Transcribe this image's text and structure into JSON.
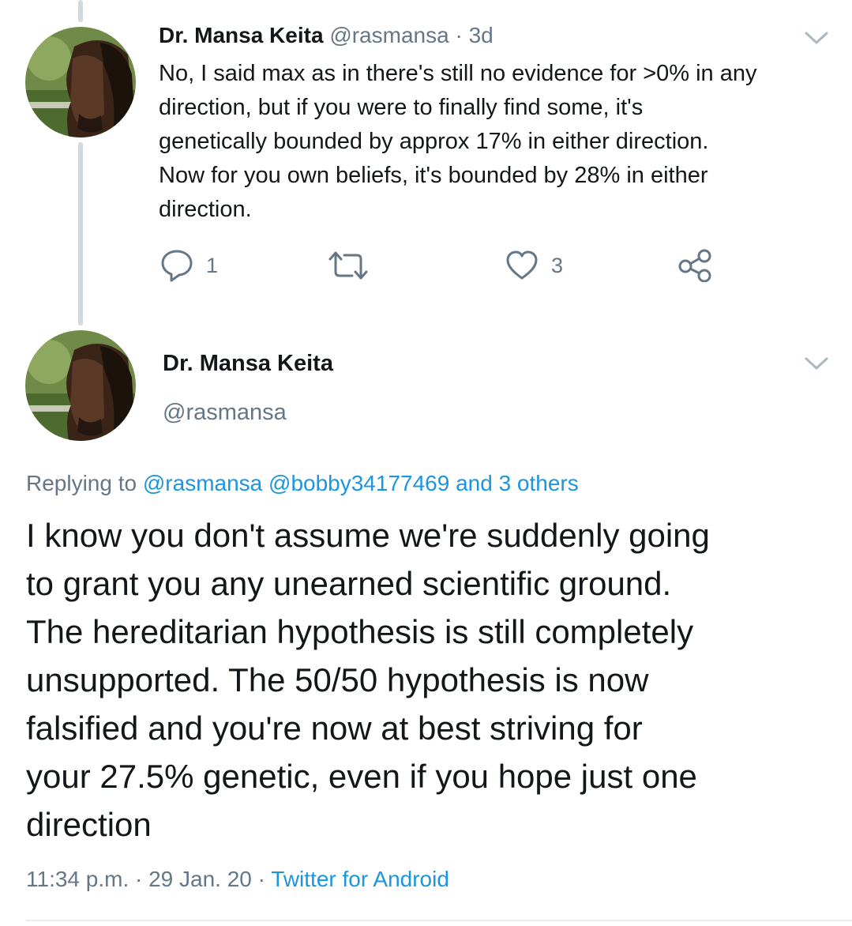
{
  "tweet1": {
    "name": "Dr. Mansa Keita",
    "handle": "@rasmansa",
    "separator": " · ",
    "time": "3d",
    "text_lines": [
      "No, I said max as in there's still no evidence for >0% in any",
      "direction, but if you were to finally find some, it's",
      "genetically bounded by approx 17% in either direction.",
      "Now for you own beliefs, it's bounded by 28% in either",
      "direction."
    ],
    "actions": {
      "reply_count": "1",
      "retweet_count": "",
      "like_count": "3"
    }
  },
  "tweet2": {
    "name": "Dr. Mansa Keita",
    "handle": "@rasmansa",
    "replying_prefix": "Replying to ",
    "replying_targets": "@rasmansa @bobby34177469 and 3 others",
    "text_lines": [
      "I know you don't assume we're suddenly going",
      "to grant you any unearned scientific ground.",
      "The hereditarian hypothesis is still completely",
      "unsupported. The 50/50 hypothesis is now",
      "falsified and you're now at best striving for",
      "your 27.5% genetic, even if you hope just one",
      "direction"
    ],
    "timestamp": "11:34 p.m. · 29 Jan. 20 · ",
    "client": "Twitter for Android"
  },
  "icons": {
    "reply": "reply-icon",
    "retweet": "retweet-icon",
    "like": "heart-icon",
    "share": "share-icon",
    "menu": "chevron-down-icon"
  },
  "colors": {
    "text": "#14171a",
    "muted": "#657786",
    "link": "#1b95e0",
    "thread_line": "#cfd9de"
  }
}
